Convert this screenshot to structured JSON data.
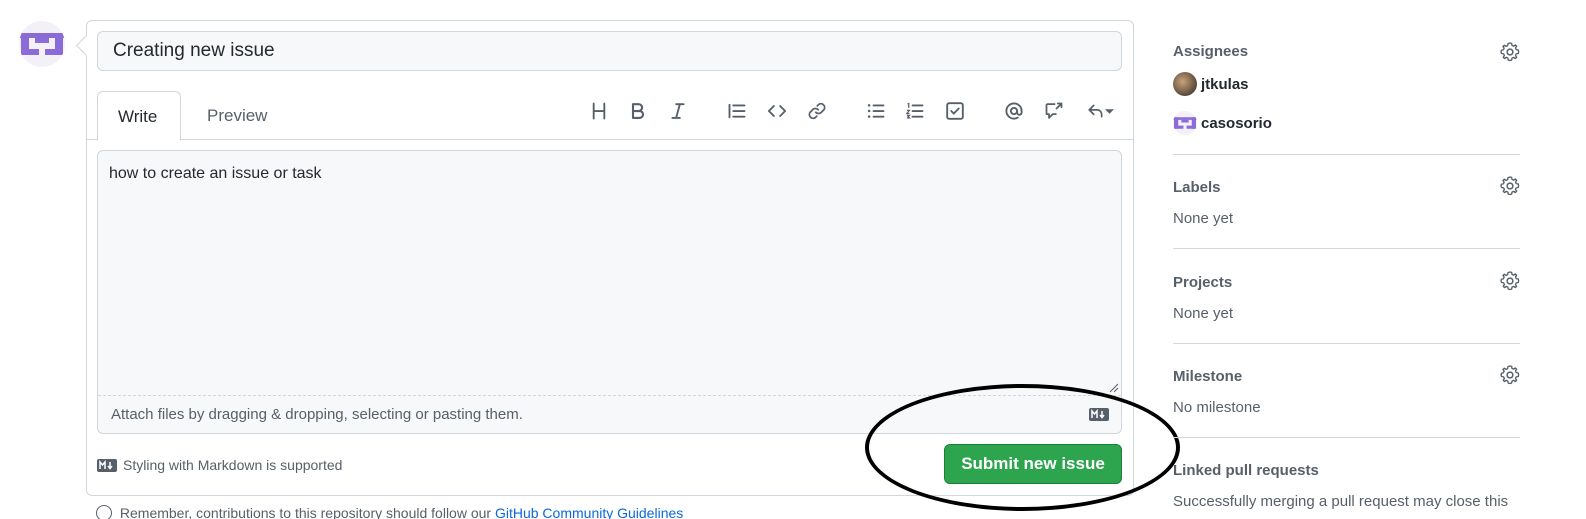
{
  "issue": {
    "title_value": "Creating new issue",
    "body_value": "how to create an issue or task"
  },
  "tabs": [
    {
      "label": "Write"
    },
    {
      "label": "Preview"
    }
  ],
  "toolbar": {
    "tools": [
      "heading-icon",
      "bold-icon",
      "italic-icon",
      "quote-icon",
      "code-icon",
      "link-icon",
      "unordered-list-icon",
      "ordered-list-icon",
      "task-list-icon",
      "mention-icon",
      "cross-reference-icon",
      "reply-icon"
    ]
  },
  "editor": {
    "attach_text": "Attach files by dragging & dropping, selecting or pasting them."
  },
  "markdown_hint": "Styling with Markdown is supported",
  "submit_label": "Submit new issue",
  "footnote": {
    "prefix": "Remember, contributions to this repository should follow our",
    "link": "GitHub Community Guidelines"
  },
  "sidebar": {
    "assignees": {
      "heading": "Assignees",
      "users": [
        "jtkulas",
        "casosorio"
      ]
    },
    "labels": {
      "heading": "Labels",
      "value": "None yet"
    },
    "projects": {
      "heading": "Projects",
      "value": "None yet"
    },
    "milestone": {
      "heading": "Milestone",
      "value": "No milestone"
    },
    "linked_prs": {
      "heading": "Linked pull requests",
      "value": "Successfully merging a pull request may close this"
    }
  },
  "colors": {
    "accent_green": "#2da44e",
    "identicon_purple": "#8b6bd6",
    "link_blue": "#0969da"
  }
}
